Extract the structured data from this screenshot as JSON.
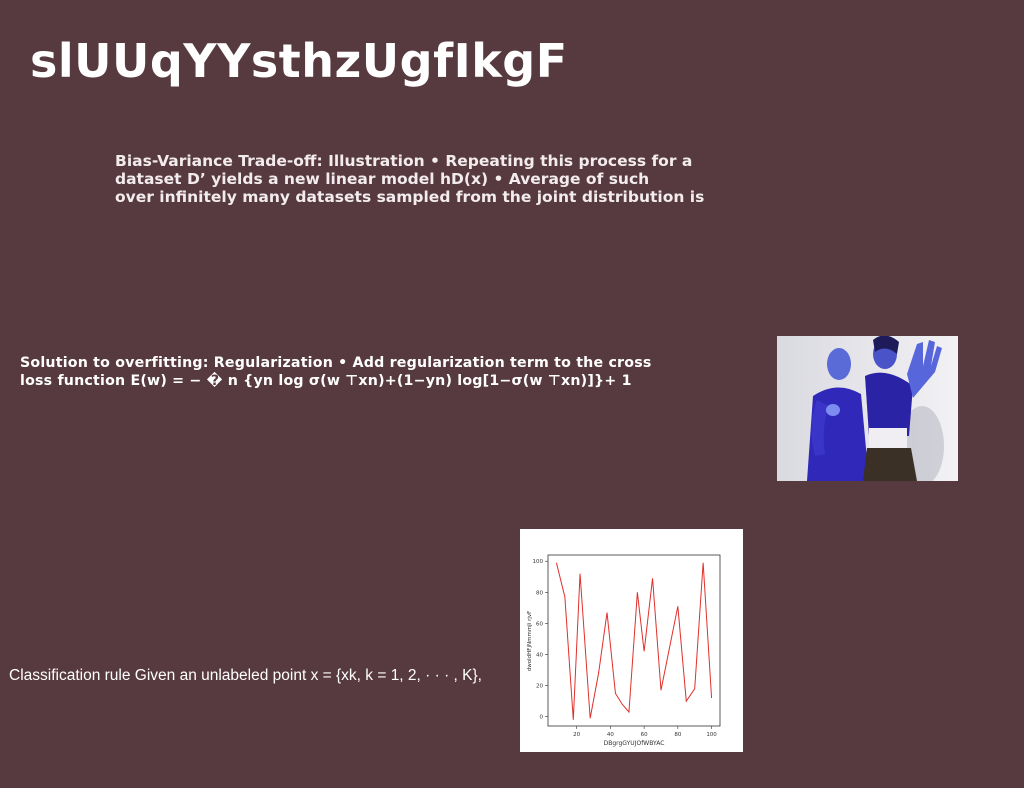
{
  "slide": {
    "title": "slUUqYYsthzUgfIkgF",
    "block1_lines": [
      "Bias-Variance Trade-off: Illustration • Repeating this process for a",
      "dataset D’ yields a new linear model hD(x) • Average of such",
      "over infinitely many datasets sampled from the joint distribution is"
    ],
    "block2_lines": [
      "Solution to overfitting: Regularization • Add regularization term to the cross",
      "loss function E(w) = − � n {yn log σ(w ⊤xn)+(1−yn) log[1−σ(w ⊤xn)]}+ 1"
    ],
    "block3_text": "Classification rule Given an unlabeled point x = {xk, k = 1, 2, · · · , K},"
  },
  "photo": {
    "icon": "photo-of-two-people"
  },
  "chart_data": {
    "type": "line",
    "x": [
      8,
      13,
      18,
      22,
      28,
      33,
      38,
      43,
      47,
      51,
      56,
      60,
      65,
      70,
      75,
      80,
      85,
      90,
      95,
      100
    ],
    "y": [
      99,
      77,
      -2,
      92,
      -1,
      28,
      67,
      15,
      8,
      3,
      80,
      42,
      89,
      17,
      44,
      71,
      10,
      18,
      99,
      12
    ],
    "xlabel": "DBgrgGYUJOfWBYAC",
    "ylabel": "dwoIdHFjNmmmJi rjvF",
    "xticks": [
      20,
      40,
      60,
      80,
      100
    ],
    "yticks": [
      0,
      20,
      40,
      60,
      80,
      100
    ],
    "xlim": [
      3,
      105
    ],
    "ylim": [
      -6,
      104
    ],
    "line_color": "#e0302a",
    "grid": false
  }
}
